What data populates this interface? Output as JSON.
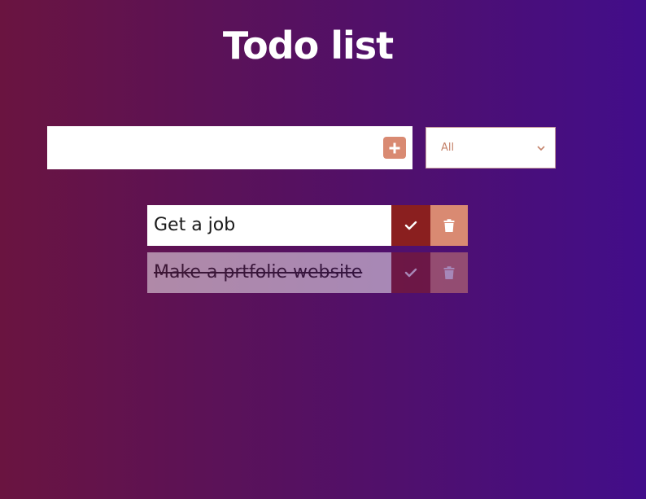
{
  "header": {
    "title": "Todo list"
  },
  "form": {
    "input_value": "",
    "add_icon": "plus-icon",
    "filter_selected": "All",
    "filter_icon": "chevron-down-icon"
  },
  "todos": [
    {
      "text": "Get a job",
      "completed": false
    },
    {
      "text": "Make a prtfolie website",
      "completed": true
    }
  ],
  "colors": {
    "gradient_start": "#6a1440",
    "gradient_end": "#420d8a",
    "check_button": "#8a1f1f",
    "trash_button": "#d98a72",
    "add_button": "#d98a72",
    "select_text": "#c4826a"
  },
  "icons": {
    "check": "check-icon",
    "trash": "trash-icon"
  }
}
